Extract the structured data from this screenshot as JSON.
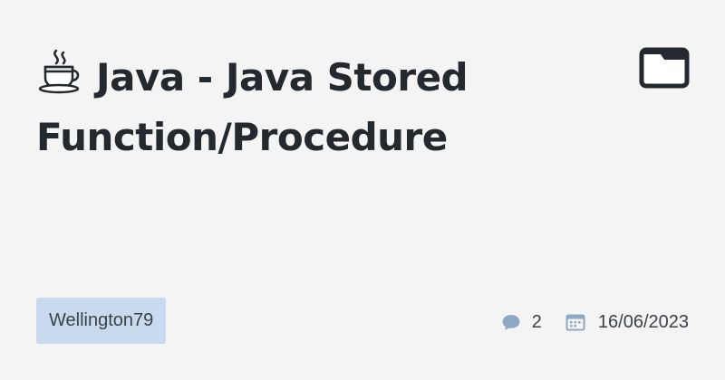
{
  "post": {
    "title": "Java - Java Stored Function/Procedure",
    "title_icon": "coffee-emoji",
    "folder_icon": "folder-icon"
  },
  "footer": {
    "author": "Wellington79",
    "comments_count": "2",
    "comments_icon": "speech-bubble-icon",
    "date": "16/06/2023",
    "date_icon": "calendar-icon"
  },
  "colors": {
    "background": "#f4f4f4",
    "badge": "#c9daee",
    "icon_muted": "#8fa8c4",
    "text": "#24292f"
  }
}
